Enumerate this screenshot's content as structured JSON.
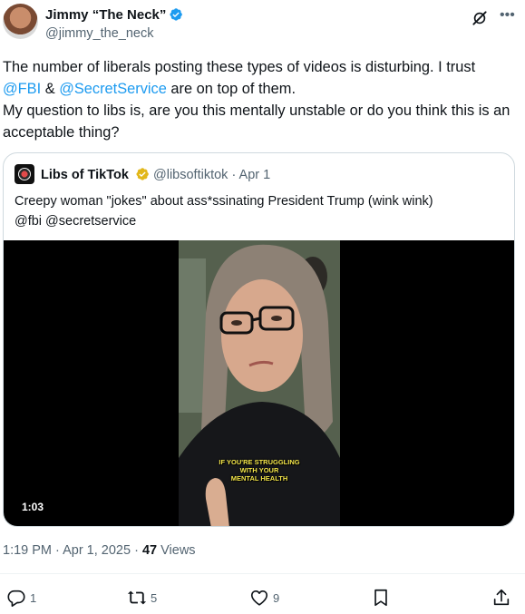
{
  "author": {
    "display_name": "Jimmy “The Neck”",
    "handle": "@jimmy_the_neck"
  },
  "header_icons": [
    "grok-icon",
    "more-icon"
  ],
  "tweet": {
    "line1_before": "The number of liberals posting these types of videos is disturbing. I trust",
    "mention_fbi": "@FBI",
    "amp": " & ",
    "mention_ss": "@SecretService",
    "line2_after": " are on top of them.",
    "line3": "My question to libs is, are you this mentally unstable or do you think this is an acceptable thing?"
  },
  "quote": {
    "display_name": "Libs of TikTok",
    "handle": "@libsoftiktok",
    "separator": " · ",
    "date": "Apr 1",
    "text_line1": "Creepy woman \"jokes\" about ass*ssinating President Trump (wink wink)",
    "text_line2": "@fbi @secretservice",
    "video": {
      "duration": "1:03",
      "caption_line1": "IF YOU'RE STRUGGLING",
      "caption_line2": "WITH YOUR",
      "caption_line3": "MENTAL HEALTH"
    }
  },
  "meta": {
    "time": "1:19 PM",
    "sep1": " · ",
    "date": "Apr 1, 2025",
    "sep2": " · ",
    "views_count": "47",
    "views_label": " Views"
  },
  "actions": {
    "replies": "1",
    "reposts": "5",
    "likes": "9"
  },
  "colors": {
    "link": "#1d9bf0",
    "secondary_text": "#536471",
    "verified_blue": "#1d9bf0",
    "verified_gold": "#e2b719",
    "caption_yellow": "#f4e64a"
  }
}
